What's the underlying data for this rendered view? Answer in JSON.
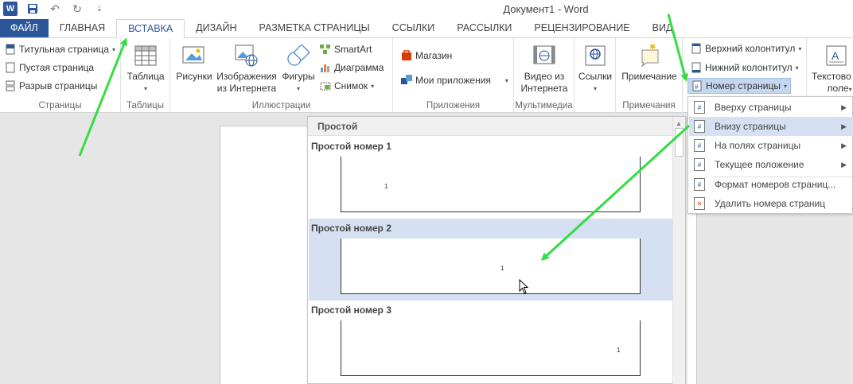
{
  "window": {
    "title": "Документ1 - Word"
  },
  "qat": {
    "app_icon": "W",
    "save": "💾",
    "undo": "↶",
    "redo": "↻",
    "more": "⇣"
  },
  "tabs": [
    {
      "label": "ФАЙЛ"
    },
    {
      "label": "ГЛАВНАЯ"
    },
    {
      "label": "ВСТАВКА"
    },
    {
      "label": "ДИЗАЙН"
    },
    {
      "label": "РАЗМЕТКА СТРАНИЦЫ"
    },
    {
      "label": "ССЫЛКИ"
    },
    {
      "label": "РАССЫЛКИ"
    },
    {
      "label": "РЕЦЕНЗИРОВАНИЕ"
    },
    {
      "label": "ВИД"
    }
  ],
  "ribbon": {
    "pages": {
      "label": "Страницы",
      "cover": "Титульная страница",
      "blank": "Пустая страница",
      "break": "Разрыв страницы"
    },
    "tables": {
      "label": "Таблицы",
      "table": "Таблица"
    },
    "illustrations": {
      "label": "Иллюстрации",
      "pictures": "Рисунки",
      "online_pictures_1": "Изображения",
      "online_pictures_2": "из Интернета",
      "shapes": "Фигуры",
      "smartart": "SmartArt",
      "chart": "Диаграмма",
      "screenshot": "Снимок"
    },
    "apps": {
      "label": "Приложения",
      "store": "Магазин",
      "my_apps": "Мои приложения"
    },
    "media": {
      "label": "Мультимедиа",
      "video_1": "Видео из",
      "video_2": "Интернета"
    },
    "links": {
      "label": "",
      "links": "Ссылки"
    },
    "comments": {
      "label": "Примечания",
      "comment": "Примечание"
    },
    "header_footer": {
      "header": "Верхний колонтитул",
      "footer": "Нижний колонтитул",
      "page_number": "Номер страницы"
    },
    "text": {
      "textbox_1": "Текстово",
      "textbox_2": "поле"
    }
  },
  "gallery": {
    "header": "Простой",
    "items": [
      {
        "title": "Простой номер 1",
        "num": "1"
      },
      {
        "title": "Простой номер 2",
        "num": "1"
      },
      {
        "title": "Простой номер 3",
        "num": "1"
      }
    ]
  },
  "menu": {
    "items": [
      {
        "label": "Вверху страницы"
      },
      {
        "label": "Внизу страницы"
      },
      {
        "label": "На полях страницы"
      },
      {
        "label": "Текущее положение"
      },
      {
        "label": "Формат номеров страниц..."
      },
      {
        "label": "Удалить номера страниц"
      }
    ]
  },
  "colors": {
    "accent": "#2b579a",
    "highlight": "#d5e1f2",
    "arrow": "#33dd44"
  }
}
